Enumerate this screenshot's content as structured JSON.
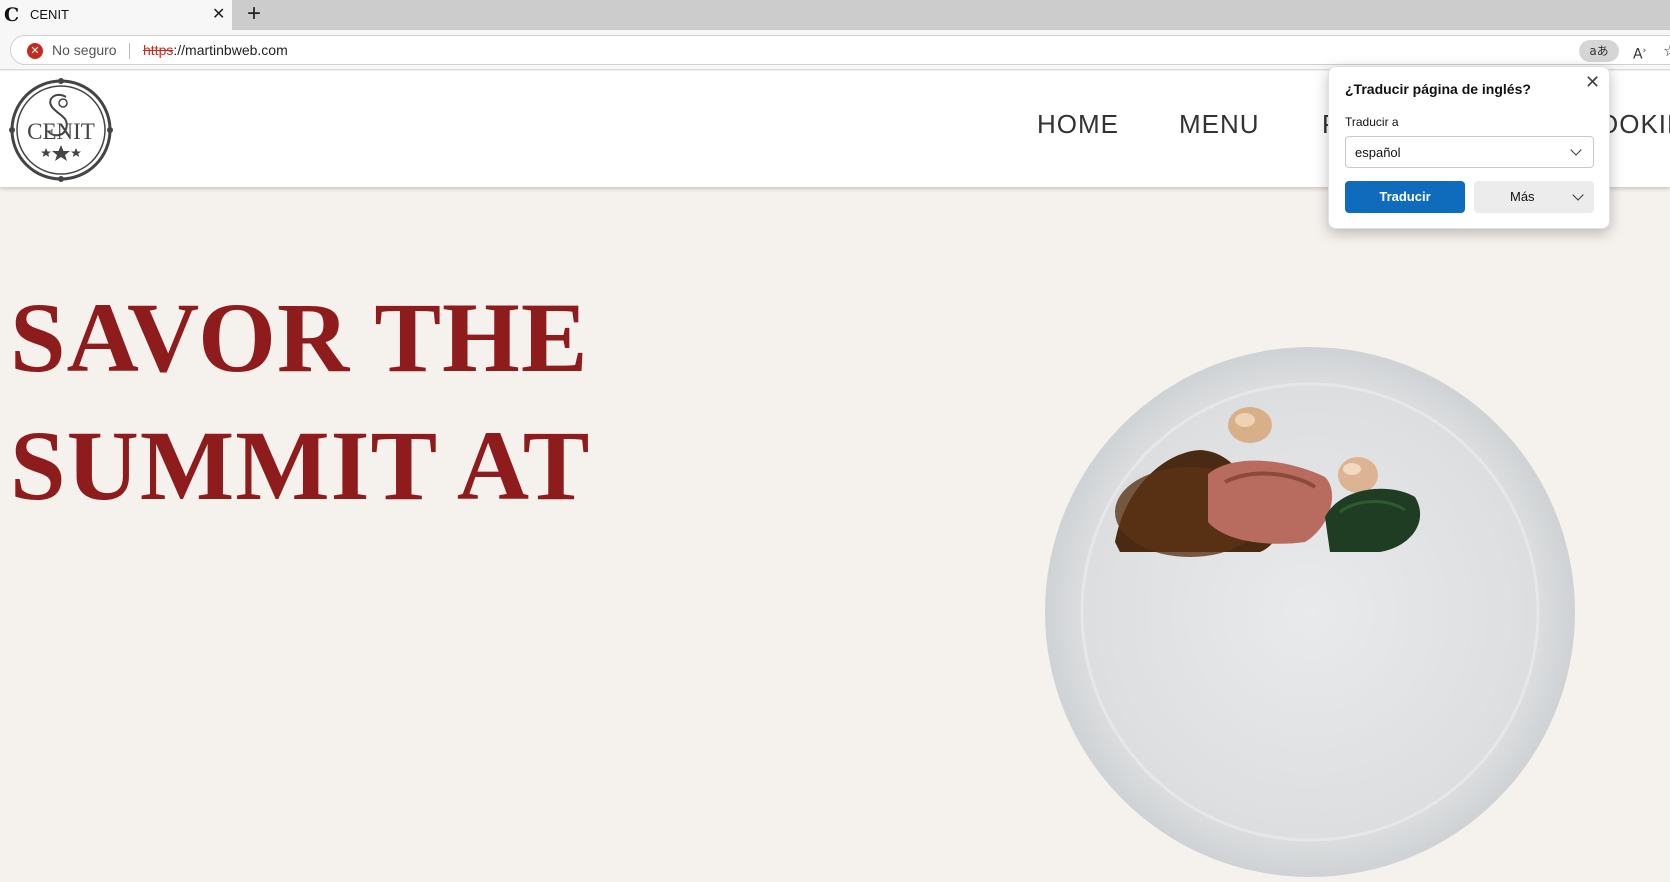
{
  "browser": {
    "tab": {
      "favicon": "C",
      "title": "CENIT"
    },
    "security_text": "No seguro",
    "url_protocol": "https",
    "url_rest": "://martinbweb.com",
    "translate_icon": "aあ",
    "read_aloud_icon": "Aᵃ",
    "favorite_icon": "☆"
  },
  "site": {
    "logo_text": "CENIT",
    "nav": [
      {
        "label": "HOME"
      },
      {
        "label": "MENU"
      },
      {
        "label": "P"
      },
      {
        "label": "OOKIN"
      }
    ],
    "hero_title_line1": "SAVOR THE",
    "hero_title_line2": "SUMMIT AT"
  },
  "translate_popup": {
    "title": "¿Traducir página de inglés?",
    "label": "Traducir a",
    "selected_language": "español",
    "translate_button": "Traducir",
    "more_button": "Más"
  },
  "colors": {
    "hero_title": "#8f1c1d",
    "page_bg": "#f5f2ee",
    "primary_button": "#0f6cbd",
    "insecure": "#c42b1c"
  }
}
